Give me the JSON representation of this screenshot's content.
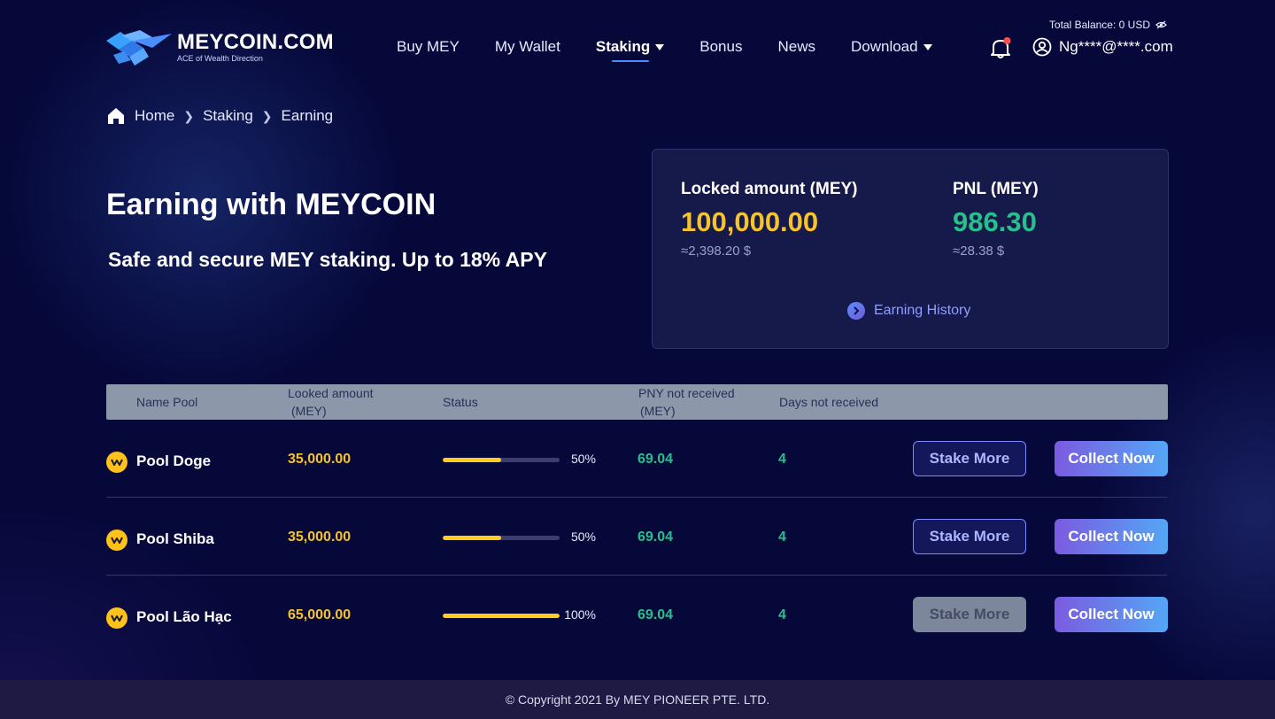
{
  "header": {
    "logo_title": "MEYCOIN.COM",
    "logo_tagline": "ACE of Wealth Direction",
    "nav": [
      {
        "label": "Buy MEY"
      },
      {
        "label": "My Wallet"
      },
      {
        "label": "Staking"
      },
      {
        "label": "Bonus"
      },
      {
        "label": "News"
      },
      {
        "label": "Download"
      }
    ],
    "balance_label": "Total Balance:",
    "balance_value": "0 USD",
    "user_email": "Ng****@****.com",
    "colors": {
      "accent": "#4a8dff",
      "notification_dot": "#ff4d4d"
    }
  },
  "breadcrumb": {
    "items": [
      "Home",
      "Staking",
      "Earning"
    ]
  },
  "hero": {
    "title": "Earning with MEYCOIN",
    "subtitle": "Safe and secure MEY staking. Up to 18% APY"
  },
  "summary": {
    "locked_label": "Locked amount (MEY)",
    "locked_value": "100,000.00",
    "locked_usd": "≈2,398.20 $",
    "pnl_label": "PNL (MEY)",
    "pnl_value": "986.30",
    "pnl_usd": "≈28.38 $",
    "history_label": "Earning History",
    "colors": {
      "locked": "#f6c32c",
      "pnl": "#27c08c"
    }
  },
  "table": {
    "headers": {
      "name": "Name Pool",
      "locked_1": "Looked amount",
      "locked_2": "(MEY)",
      "status": "Status",
      "pny_1": "PNY not received",
      "pny_2": "(MEY)",
      "days": "Days not received"
    },
    "rows": [
      {
        "name": "Pool Doge",
        "amount": "35,000.00",
        "progress": 0.5,
        "pct": "50%",
        "pny": "69.04",
        "days": "4",
        "stake_label": "Stake More",
        "stake_enabled": true,
        "collect_label": "Collect Now"
      },
      {
        "name": "Pool Shiba",
        "amount": "35,000.00",
        "progress": 0.5,
        "pct": "50%",
        "pny": "69.04",
        "days": "4",
        "stake_label": "Stake More",
        "stake_enabled": true,
        "collect_label": "Collect Now"
      },
      {
        "name": "Pool Lão Hạc",
        "amount": "65,000.00",
        "progress": 1.0,
        "pct": "100%",
        "pny": "69.04",
        "days": "4",
        "stake_label": "Stake More",
        "stake_enabled": false,
        "collect_label": "Collect Now"
      }
    ]
  },
  "footer": {
    "copyright": "© Copyright 2021 By MEY PIONEER PTE. LTD."
  }
}
